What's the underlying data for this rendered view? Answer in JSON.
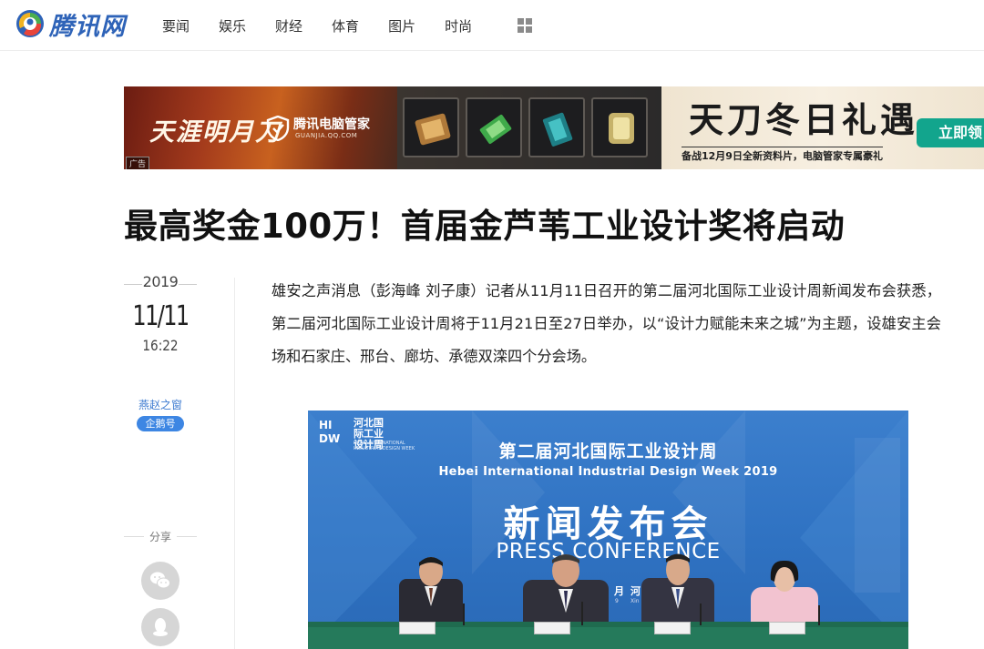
{
  "header": {
    "logo_text": "腾讯网",
    "nav": [
      "要闻",
      "娱乐",
      "财经",
      "体育",
      "图片",
      "时尚"
    ]
  },
  "banner": {
    "brand": "天涯明月刀",
    "guard_name": "腾讯电脑管家",
    "guard_url": "GUANJIA.QQ.COM",
    "title": "天刀冬日礼遇",
    "subtitle": "备战12月9日全新资料片，电脑管家专属豪礼",
    "cta": "立即领",
    "ad_tag": "广告"
  },
  "article": {
    "headline": "最高奖金100万！首届金芦苇工业设计奖将启动",
    "year": "2019",
    "date": "11/11",
    "time": "16:22",
    "source": "燕赵之窗",
    "source_tag": "企鹅号",
    "share_label": "分享",
    "body": "雄安之声消息（彭海峰 刘子康）记者从11月11日召开的第二届河北国际工业设计周新闻发布会获悉，第二届河北国际工业设计周将于11月21日至27日举办，以“设计力赋能未来之城”为主题，设雄安主会场和石家庄、邢台、廊坊、承德双滦四个分会场。"
  },
  "photo": {
    "logo_cn": "河北国际工业设计周",
    "logo_en": "HEBEI INTERNATIONAL INDUSTRIAL DESIGN WEEK",
    "logo_abbr": "HIDW",
    "title_cn": "第二届河北国际工业设计周",
    "title_en": "Hebei International Industrial Design Week 2019",
    "big": "新闻发布会",
    "conference": "PRESS CONFERENCE",
    "date": "月",
    "location": "河",
    "date_sub": "9",
    "location_sub": "Xin"
  },
  "colors": {
    "accent_blue": "#3d86e3",
    "logo_blue": "#2e63b8",
    "cta_green": "#12a58d",
    "photo_blue": "#3c7fcd"
  }
}
